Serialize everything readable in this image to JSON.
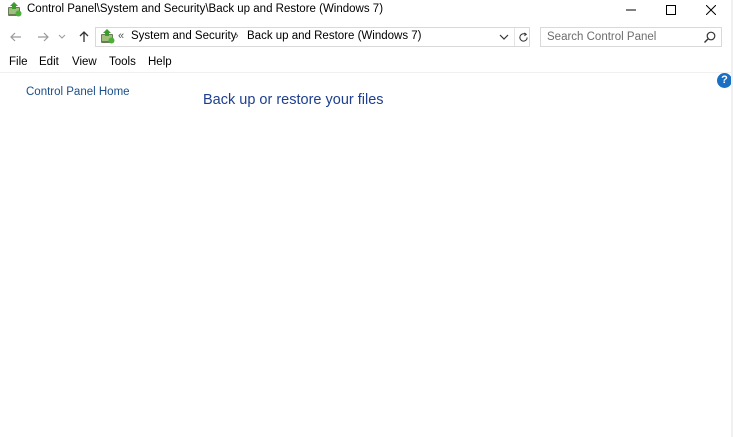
{
  "window": {
    "title": "Control Panel\\System and Security\\Back up and Restore (Windows 7)"
  },
  "address_bar": {
    "overflow_chevron": "«",
    "crumbs": [
      "System and Security",
      "Back up and Restore (Windows 7)"
    ],
    "separator": "›"
  },
  "search": {
    "placeholder": "Search Control Panel",
    "value": ""
  },
  "menu": {
    "items": [
      "File",
      "Edit",
      "View",
      "Tools",
      "Help"
    ]
  },
  "help_badge": "?",
  "sidebar": {
    "home_link": "Control Panel Home"
  },
  "main": {
    "heading": "Back up or restore your files"
  },
  "colors": {
    "link": "#1a4f8a",
    "heading": "#1e3f8f",
    "help_blue": "#1a6fc4"
  }
}
